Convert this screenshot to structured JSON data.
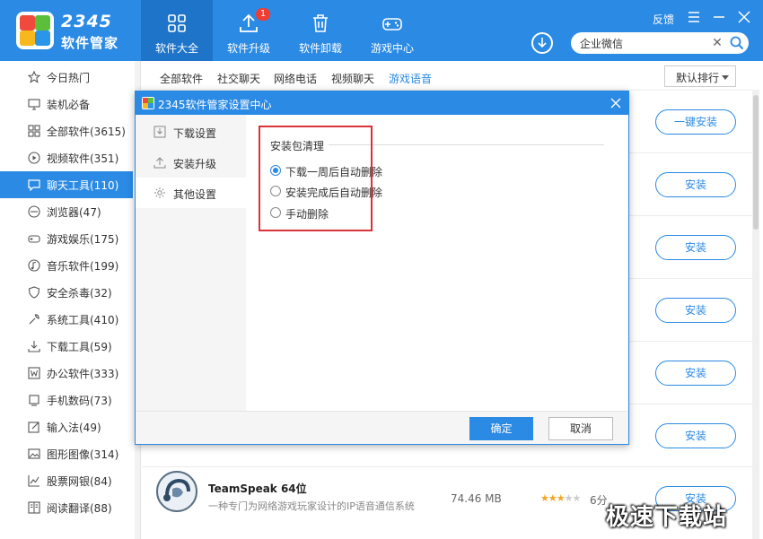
{
  "brand": {
    "number": "2345",
    "name": "软件管家"
  },
  "nav": [
    {
      "label": "软件大全",
      "icon": "grid-icon",
      "active": true
    },
    {
      "label": "软件升级",
      "icon": "upload-icon",
      "badge": "1"
    },
    {
      "label": "软件卸载",
      "icon": "trash-icon"
    },
    {
      "label": "游戏中心",
      "icon": "gamepad-icon"
    }
  ],
  "window": {
    "feedback": "反馈",
    "menu_icon": "menu-icon",
    "close_icon": "close-icon"
  },
  "search": {
    "value": "企业微信"
  },
  "sidebar": [
    {
      "label": "今日热门",
      "icon": "star-icon"
    },
    {
      "label": "装机必备",
      "icon": "monitor-icon"
    },
    {
      "label": "全部软件(3615)",
      "icon": "apps-icon"
    },
    {
      "label": "视频软件(351)",
      "icon": "play-icon"
    },
    {
      "label": "聊天工具(110)",
      "icon": "chat-icon",
      "active": true
    },
    {
      "label": "浏览器(47)",
      "icon": "browser-icon"
    },
    {
      "label": "游戏娱乐(175)",
      "icon": "game-icon"
    },
    {
      "label": "音乐软件(199)",
      "icon": "music-icon"
    },
    {
      "label": "安全杀毒(32)",
      "icon": "shield-icon"
    },
    {
      "label": "系统工具(410)",
      "icon": "tools-icon"
    },
    {
      "label": "下载工具(59)",
      "icon": "download-icon"
    },
    {
      "label": "办公软件(333)",
      "icon": "word-icon"
    },
    {
      "label": "手机数码(73)",
      "icon": "phone-icon"
    },
    {
      "label": "输入法(49)",
      "icon": "edit-icon"
    },
    {
      "label": "图形图像(314)",
      "icon": "image-icon"
    },
    {
      "label": "股票网银(84)",
      "icon": "chart-icon"
    },
    {
      "label": "阅读翻译(88)",
      "icon": "book-icon"
    }
  ],
  "subtabs": [
    "全部软件",
    "社交聊天",
    "网络电话",
    "视频聊天",
    "游戏语音"
  ],
  "sort": {
    "value": "默认排行"
  },
  "install_buttons": [
    "一键安装",
    "安装",
    "安装",
    "安装",
    "安装",
    "安装",
    "安装"
  ],
  "app": {
    "name": "TeamSpeak 64位",
    "desc": "一种专门为网络游戏玩家设计的IP语音通信系统",
    "size": "74.46 MB",
    "rating": 3,
    "score": "6分"
  },
  "dialog": {
    "title": "2345软件管家设置中心",
    "nav": [
      {
        "label": "下载设置",
        "icon": "download-settings-icon"
      },
      {
        "label": "安装升级",
        "icon": "upgrade-icon"
      },
      {
        "label": "其他设置",
        "icon": "gear-icon",
        "active": true
      }
    ],
    "section_title": "安装包清理",
    "options": [
      {
        "label": "下载一周后自动删除",
        "checked": true
      },
      {
        "label": "安装完成后自动删除",
        "checked": false
      },
      {
        "label": "手动删除",
        "checked": false
      }
    ],
    "ok": "确定",
    "cancel": "取消"
  },
  "watermark": "极速下载站",
  "colors": {
    "accent": "#2b8ae4",
    "highlight": "#d8323a"
  }
}
